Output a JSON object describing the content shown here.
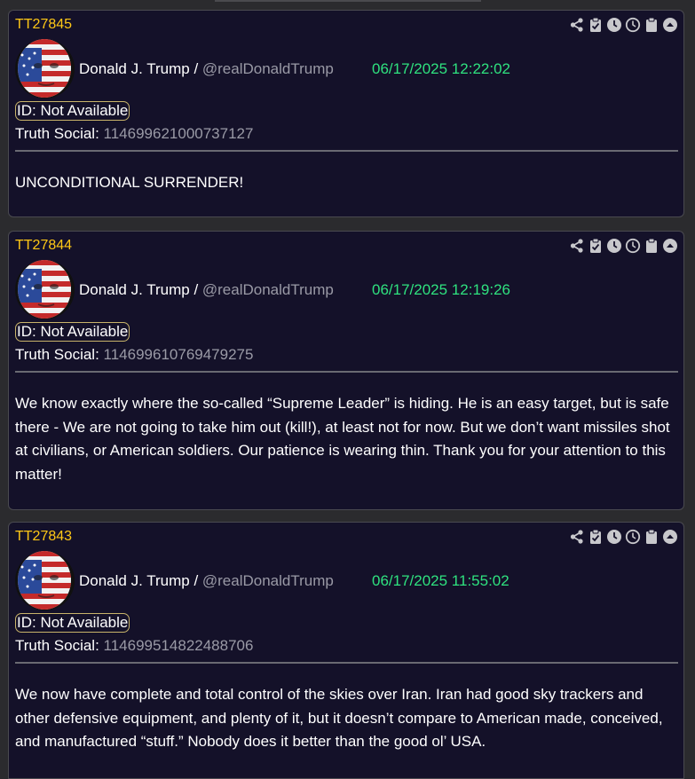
{
  "posts": [
    {
      "id": "TT27845",
      "author_name": "Donald J. Trump / ",
      "handle": "@realDonaldTrump",
      "timestamp": "06/17/2025 12:22:02",
      "id_label": "ID: Not Available",
      "truth_label": "Truth Social: ",
      "truth_id": "114699621000737127",
      "text": "UNCONDITIONAL SURRENDER!"
    },
    {
      "id": "TT27844",
      "author_name": "Donald J. Trump / ",
      "handle": "@realDonaldTrump",
      "timestamp": "06/17/2025 12:19:26",
      "id_label": "ID: Not Available",
      "truth_label": "Truth Social: ",
      "truth_id": "114699610769479275",
      "text": "We know exactly where the so-called “Supreme Leader” is hiding. He is an easy target, but is safe there - We are not going to take him out (kill!), at least not for now. But we don’t want missiles shot at civilians, or American soldiers. Our patience is wearing thin. Thank you for your attention to this matter!"
    },
    {
      "id": "TT27843",
      "author_name": "Donald J. Trump / ",
      "handle": "@realDonaldTrump",
      "timestamp": "06/17/2025 11:55:02",
      "id_label": "ID: Not Available",
      "truth_label": "Truth Social: ",
      "truth_id": "114699514822488706",
      "text": "We now have complete and total control of the skies over Iran. Iran had good sky trackers and other defensive equipment, and plenty of it, but it doesn’t compare to American made, conceived, and manufactured “stuff.”  Nobody does it better than the good ol’ USA."
    }
  ],
  "toolbar_icons": [
    "share-icon",
    "clipboard-check-icon",
    "clock-solid-icon",
    "clock-outline-icon",
    "clipboard-icon",
    "chevron-up-circle-icon"
  ],
  "colors": {
    "background": "#2b2b2e",
    "card": "#141129",
    "post_id": "#ffc816",
    "timestamp": "#2fe27f",
    "muted": "#9a9aa6"
  }
}
